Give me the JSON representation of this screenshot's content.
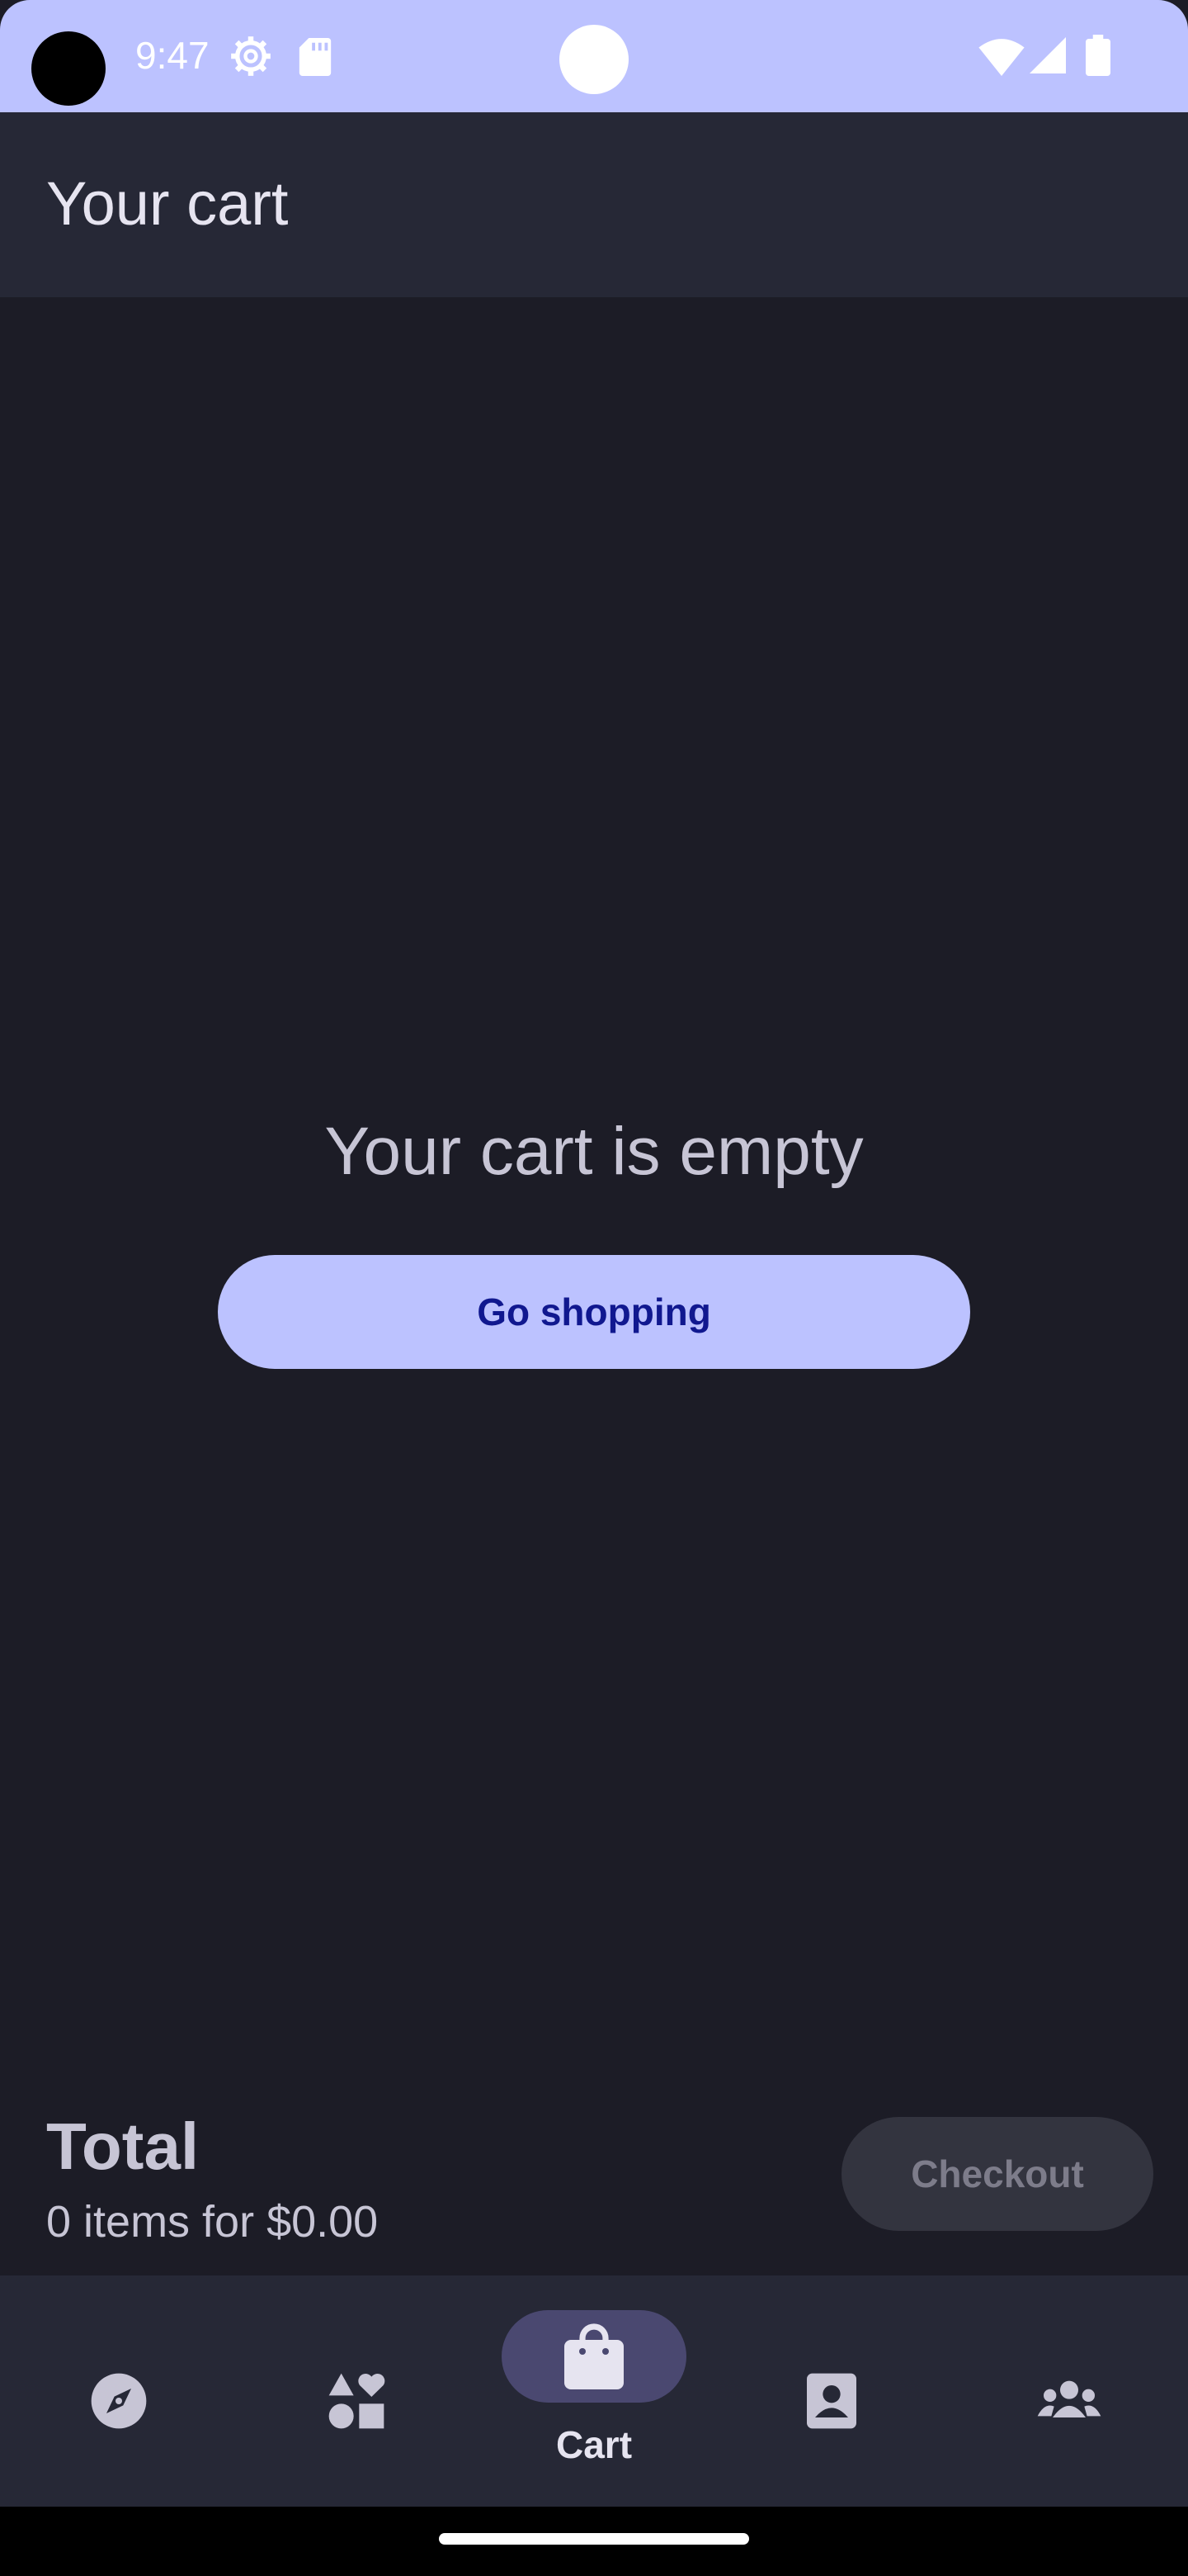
{
  "status_bar": {
    "time": "9:47",
    "icons": [
      "settings-gear-icon",
      "sd-card-icon",
      "wifi-icon",
      "cell-signal-icon",
      "battery-icon"
    ],
    "background": "#bcc2ff"
  },
  "app_bar": {
    "title": "Your cart"
  },
  "main": {
    "empty_message": "Your cart is empty",
    "go_shopping_label": "Go shopping"
  },
  "summary": {
    "total_label": "Total",
    "items_text": "0 items for $0.00",
    "checkout_label": "Checkout",
    "checkout_enabled": false
  },
  "bottom_nav": {
    "items": [
      {
        "icon": "compass-icon",
        "label": ""
      },
      {
        "icon": "shapes-icon",
        "label": ""
      },
      {
        "icon": "shopping-bag-icon",
        "label": "Cart",
        "selected": true
      },
      {
        "icon": "contact-card-icon",
        "label": ""
      },
      {
        "icon": "people-group-icon",
        "label": ""
      }
    ]
  },
  "colors": {
    "background": "#1c1c26",
    "surface": "#262836",
    "accent": "#bcc2ff",
    "accent_text": "#10188f",
    "nav_active_pill": "#4a4870"
  }
}
